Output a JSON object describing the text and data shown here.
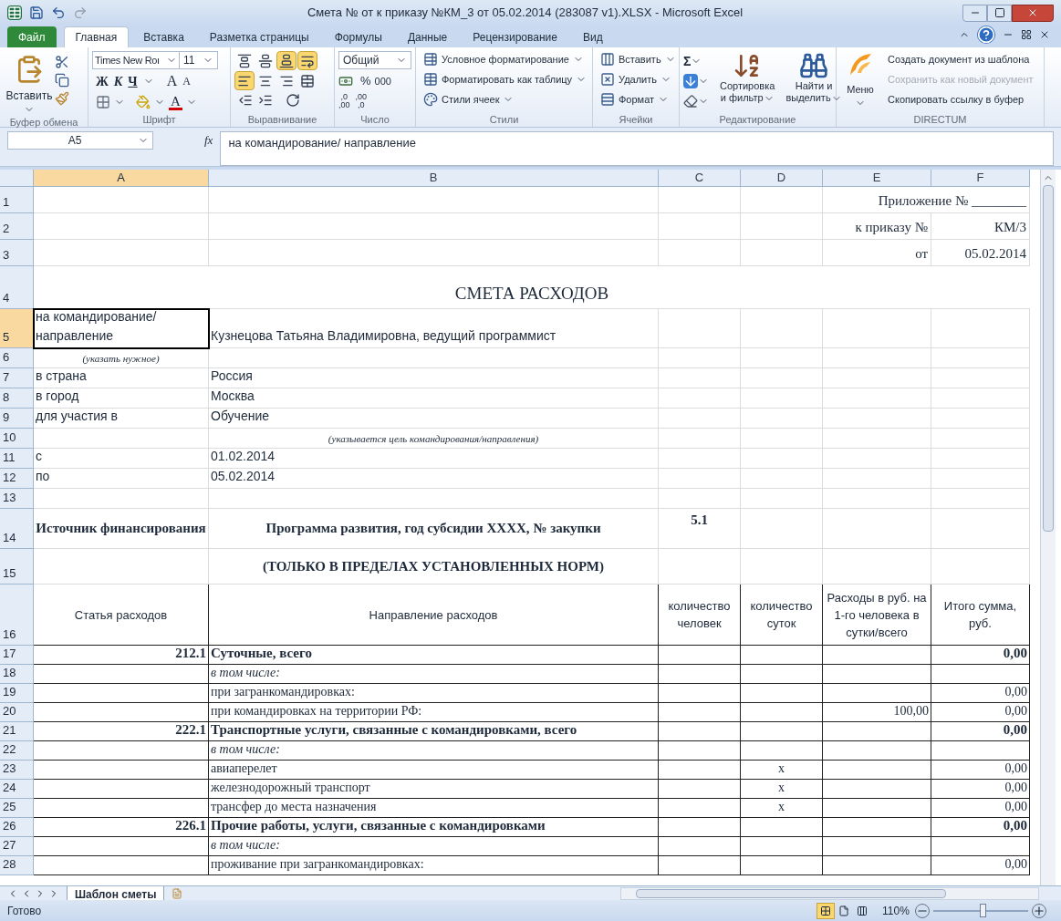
{
  "window": {
    "title": "Смета № от  к приказу №КМ_3 от 05.02.2014 (283087 v1).XLSX  -  Microsoft Excel"
  },
  "tabs": [
    {
      "label": "Файл",
      "kind": "file",
      "selected": false
    },
    {
      "label": "Главная",
      "kind": "tab",
      "selected": true
    },
    {
      "label": "Вставка",
      "kind": "tab",
      "selected": false
    },
    {
      "label": "Разметка страницы",
      "kind": "tab",
      "selected": false
    },
    {
      "label": "Формулы",
      "kind": "tab",
      "selected": false
    },
    {
      "label": "Данные",
      "kind": "tab",
      "selected": false
    },
    {
      "label": "Рецензирование",
      "kind": "tab",
      "selected": false
    },
    {
      "label": "Вид",
      "kind": "tab",
      "selected": false
    }
  ],
  "ribbon": {
    "clipboard": {
      "paste": "Вставить",
      "label": "Буфер обмена"
    },
    "font": {
      "name": "Times New Roı",
      "size": "11",
      "bold": "Ж",
      "italic": "К",
      "underline": "Ч",
      "grow": "A",
      "shrink": "A",
      "color_letter": "A",
      "label": "Шрифт"
    },
    "alignment": {
      "label": "Выравнивание",
      "vertical": [
        {
          "kind": "top",
          "selected": false
        },
        {
          "kind": "middle",
          "selected": false
        },
        {
          "kind": "bottom",
          "selected": true
        },
        {
          "kind": "wrap",
          "selected": true
        }
      ],
      "horizontal": [
        {
          "kind": "left",
          "selected": true
        },
        {
          "kind": "center",
          "selected": false
        },
        {
          "kind": "right",
          "selected": false
        },
        {
          "kind": "merge",
          "selected": false
        }
      ]
    },
    "number": {
      "format": "Общий",
      "percent": "%",
      "thousands": "000",
      "increase": [
        ",0",
        ",00"
      ],
      "decrease": [
        ",00",
        ",0"
      ],
      "label": "Число"
    },
    "styles": {
      "items": [
        "Условное форматирование",
        "Форматировать как таблицу",
        "Стили ячеек"
      ],
      "label": "Стили"
    },
    "cells": {
      "items": [
        "Вставить",
        "Удалить",
        "Формат"
      ],
      "label": "Ячейки"
    },
    "editing": {
      "sum": "Σ",
      "sort": [
        "Сортировка",
        "и фильтр"
      ],
      "find": [
        "Найти и",
        "выделить"
      ],
      "label": "Редактирование"
    },
    "directum": {
      "menu": "Меню",
      "items": [
        {
          "label": "Создать документ из шаблона",
          "disabled": false
        },
        {
          "label": "Сохранить как новый документ",
          "disabled": true
        },
        {
          "label": "Скопировать ссылку в буфер",
          "disabled": false
        }
      ],
      "label": "DIRECTUM"
    }
  },
  "formula_bar": {
    "name_box": "A5",
    "fx": "fx",
    "value": "на командирование/ направление"
  },
  "columns": [
    {
      "label": "A",
      "selected": true
    },
    {
      "label": "B",
      "selected": false
    },
    {
      "label": "C",
      "selected": false
    },
    {
      "label": "D",
      "selected": false
    },
    {
      "label": "E",
      "selected": false
    },
    {
      "label": "F",
      "selected": false
    }
  ],
  "rows": [
    {
      "num": "1",
      "kind": "meta",
      "selected": false,
      "cells": {
        "f": "Приложение № ________"
      }
    },
    {
      "num": "2",
      "kind": "meta",
      "selected": false,
      "cells": {
        "e": "к приказу  №",
        "f": "КМ/3"
      }
    },
    {
      "num": "3",
      "kind": "meta",
      "selected": false,
      "cells": {
        "e": "от",
        "f": "05.02.2014"
      }
    },
    {
      "num": "4",
      "kind": "title",
      "selected": false,
      "cells": {
        "a": "СМЕТА РАСХОДОВ"
      }
    },
    {
      "num": "5",
      "kind": "label",
      "selected": true,
      "cells": {
        "a": "на командирование/ направление",
        "b": "Кузнецова Татьяна Владимировна, ведущий программист"
      }
    },
    {
      "num": "6",
      "kind": "hint",
      "selected": false,
      "cells": {
        "a": "(указать нужное)"
      }
    },
    {
      "num": "7",
      "kind": "label",
      "selected": false,
      "cells": {
        "a": "в страна",
        "b": "Россия"
      }
    },
    {
      "num": "8",
      "kind": "label",
      "selected": false,
      "cells": {
        "a": "в  город",
        "b": "Москва"
      }
    },
    {
      "num": "9",
      "kind": "label",
      "selected": false,
      "cells": {
        "a": "для участия в",
        "b": "Обучение"
      }
    },
    {
      "num": "10",
      "kind": "hint",
      "selected": false,
      "cells": {
        "b": "(указывается цель командирования/направления)"
      }
    },
    {
      "num": "11",
      "kind": "label",
      "selected": false,
      "cells": {
        "a": "с",
        "b": "01.02.2014"
      }
    },
    {
      "num": "12",
      "kind": "label",
      "selected": false,
      "cells": {
        "a": "по",
        "b": "05.02.2014"
      }
    },
    {
      "num": "13",
      "kind": "blank",
      "selected": false,
      "cells": {}
    },
    {
      "num": "14",
      "kind": "section",
      "selected": false,
      "cells": {
        "a": "Источник финансирования",
        "b": "Программа развития, год субсидии XXXX, № закупки",
        "c": "5.1"
      }
    },
    {
      "num": "15",
      "kind": "section",
      "selected": false,
      "cells": {
        "b": "(ТОЛЬКО В ПРЕДЕЛАХ УСТАНОВЛЕННЫХ НОРМ)"
      }
    },
    {
      "num": "16",
      "kind": "table_header",
      "selected": false,
      "cells": {
        "a": "Статья расходов",
        "b": "Направление расходов",
        "c": "количество человек",
        "d": "количество суток",
        "e": "Расходы в руб. на 1-го человека в сутки/всего",
        "f": "Итого сумма, руб."
      }
    },
    {
      "num": "17",
      "kind": "total",
      "selected": false,
      "cells": {
        "a": "212.1",
        "b": "Суточные, всего",
        "f": "0,00"
      }
    },
    {
      "num": "18",
      "kind": "subhead",
      "selected": false,
      "cells": {
        "b": "в том числе:"
      }
    },
    {
      "num": "19",
      "kind": "item",
      "selected": false,
      "cells": {
        "b": "при загранкомандировках:",
        "f": "0,00"
      }
    },
    {
      "num": "20",
      "kind": "item",
      "selected": false,
      "cells": {
        "b": "при командировках на территории РФ:",
        "e": "100,00",
        "f": "0,00"
      }
    },
    {
      "num": "21",
      "kind": "total",
      "selected": false,
      "cells": {
        "a": "222.1",
        "b": "Транспортные услуги, связанные с командировками, всего",
        "f": "0,00"
      }
    },
    {
      "num": "22",
      "kind": "subhead",
      "selected": false,
      "cells": {
        "b": "в том числе:"
      }
    },
    {
      "num": "23",
      "kind": "item",
      "selected": false,
      "cells": {
        "b": "авиаперелет",
        "d": "x",
        "f": "0,00"
      }
    },
    {
      "num": "24",
      "kind": "item",
      "selected": false,
      "cells": {
        "b": "железнодорожный транспорт",
        "d": "x",
        "f": "0,00"
      }
    },
    {
      "num": "25",
      "kind": "item",
      "selected": false,
      "cells": {
        "b": "трансфер до места назначения",
        "d": "x",
        "f": "0,00"
      }
    },
    {
      "num": "26",
      "kind": "total",
      "selected": false,
      "cells": {
        "a": "226.1",
        "b": "Прочие работы, услуги, связанные с командировками",
        "f": "0,00"
      }
    },
    {
      "num": "27",
      "kind": "subhead",
      "selected": false,
      "cells": {
        "b": "в том числе:"
      }
    },
    {
      "num": "28",
      "kind": "item",
      "selected": false,
      "cells": {
        "b": "проживание при загранкомандировках:",
        "f": "0,00"
      }
    }
  ],
  "sheet_tabs": [
    {
      "label": "Шаблон сметы",
      "selected": true
    }
  ],
  "status_bar": {
    "status": "Готово",
    "views": [
      {
        "kind": "normal",
        "selected": true
      },
      {
        "kind": "layout",
        "selected": false
      },
      {
        "kind": "break",
        "selected": false
      }
    ],
    "zoom": "110%",
    "zoom_slider": {
      "level": 0.52
    }
  }
}
